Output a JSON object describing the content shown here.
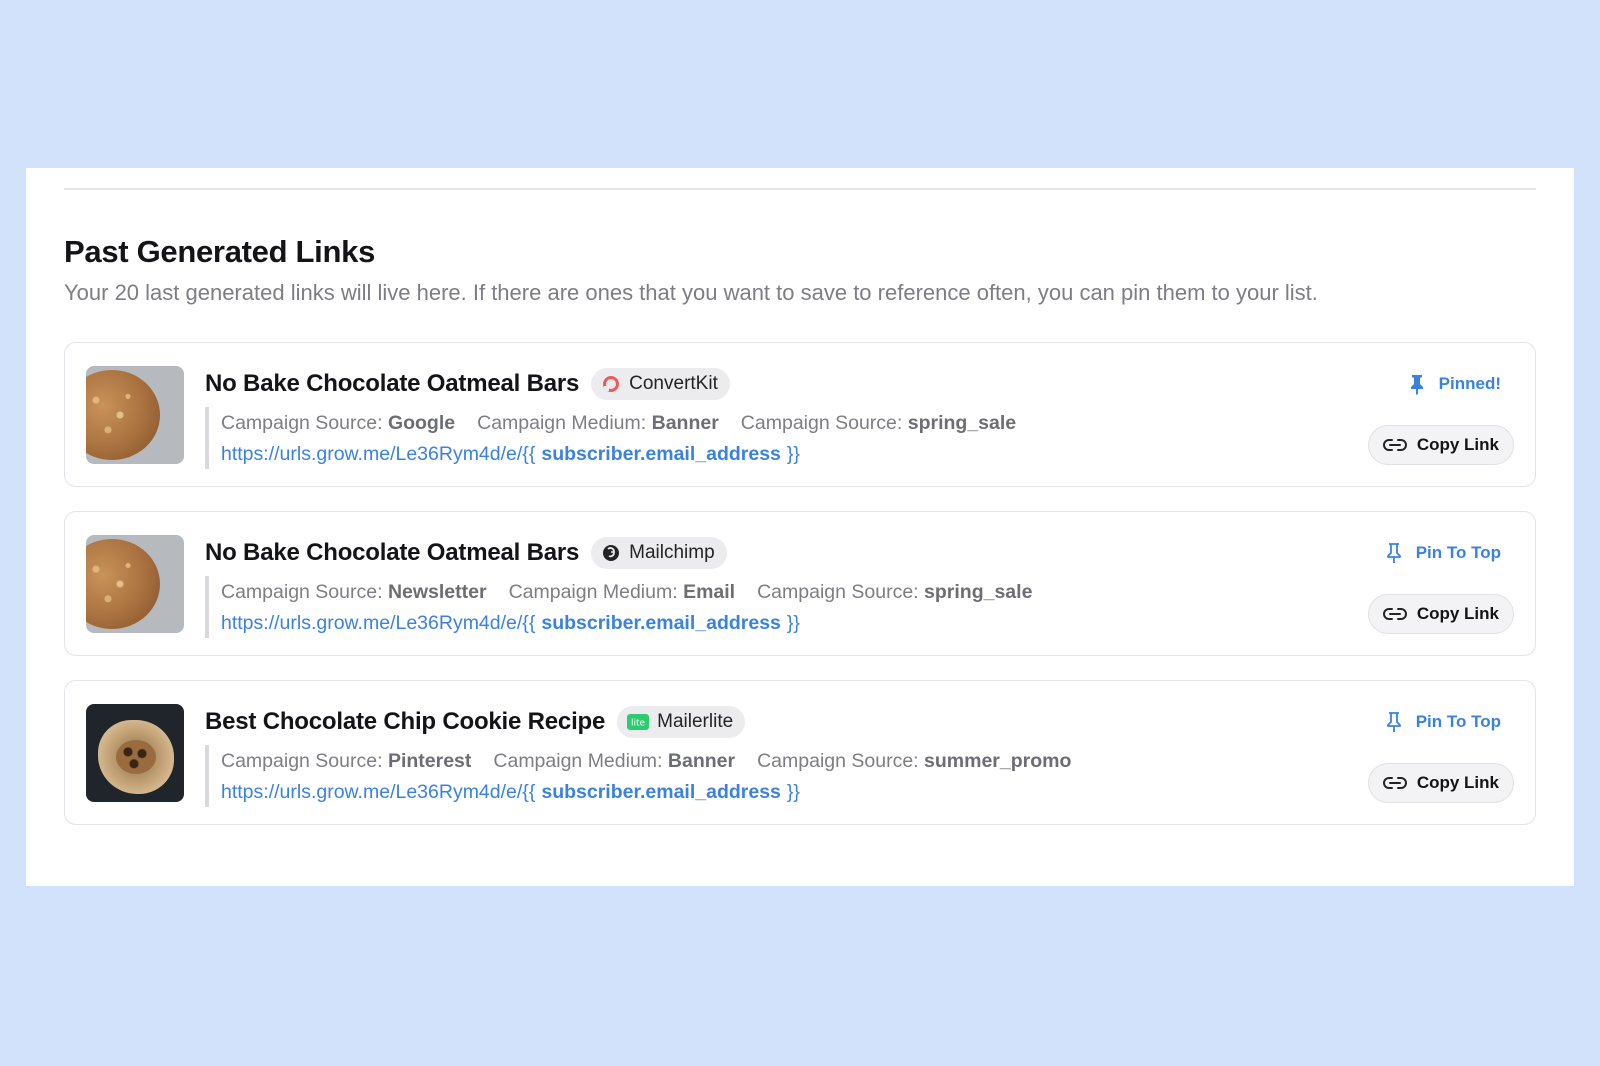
{
  "section": {
    "title": "Past Generated Links",
    "description": "Your 20 last generated links will live here. If there are ones that you want to save to reference often, you can pin them to your list."
  },
  "colors": {
    "accent": "#3b82e0",
    "page_bg": "#d3e2fb",
    "convertkit": "#ee5a5a",
    "mailerlite": "#2ecc71"
  },
  "links": [
    {
      "title": "No Bake Chocolate Oatmeal Bars",
      "provider": "ConvertKit",
      "provider_icon": "convertkit-icon",
      "thumbnail": "oatmeal-bars-image",
      "source_label": "Campaign Source:",
      "source_value": "Google",
      "medium_label": "Campaign Medium:",
      "medium_value": "Banner",
      "campaign_label": "Campaign Source:",
      "campaign_value": "spring_sale",
      "url_prefix": "https://urls.grow.me/Le36Rym4d/e/{{",
      "url_var": "subscriber.email_address",
      "url_suffix": "}}",
      "pin_label": "Pinned!",
      "pinned": true,
      "copy_label": "Copy Link"
    },
    {
      "title": "No Bake Chocolate Oatmeal Bars",
      "provider": "Mailchimp",
      "provider_icon": "mailchimp-icon",
      "thumbnail": "oatmeal-bars-image",
      "source_label": "Campaign Source:",
      "source_value": "Newsletter",
      "medium_label": "Campaign Medium:",
      "medium_value": "Email",
      "campaign_label": "Campaign Source:",
      "campaign_value": "spring_sale",
      "url_prefix": "https://urls.grow.me/Le36Rym4d/e/{{",
      "url_var": "subscriber.email_address",
      "url_suffix": "}}",
      "pin_label": "Pin To Top",
      "pinned": false,
      "copy_label": "Copy Link"
    },
    {
      "title": "Best Chocolate Chip Cookie Recipe",
      "provider": "Mailerlite",
      "provider_icon": "mailerlite-icon",
      "provider_icon_text": "lite",
      "thumbnail": "chocolate-chip-cookies-image",
      "source_label": "Campaign Source:",
      "source_value": "Pinterest",
      "medium_label": "Campaign Medium:",
      "medium_value": "Banner",
      "campaign_label": "Campaign Source:",
      "campaign_value": "summer_promo",
      "url_prefix": "https://urls.grow.me/Le36Rym4d/e/{{",
      "url_var": "subscriber.email_address",
      "url_suffix": "}}",
      "pin_label": "Pin To Top",
      "pinned": false,
      "copy_label": "Copy Link"
    }
  ]
}
